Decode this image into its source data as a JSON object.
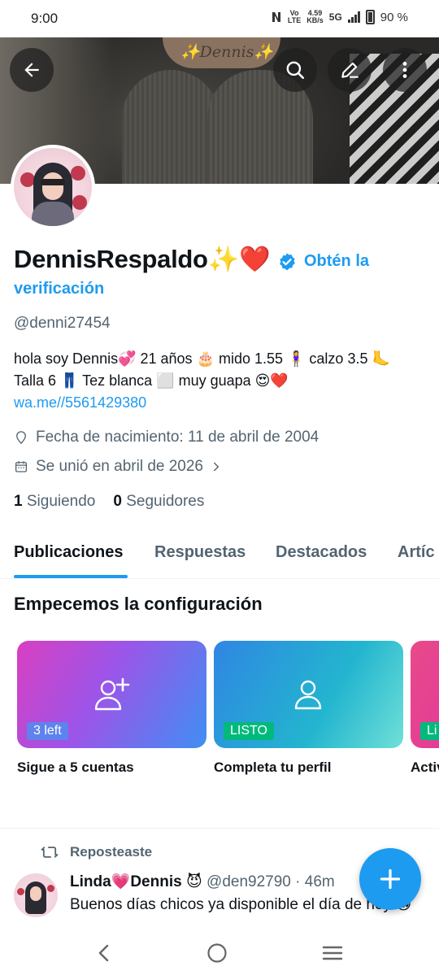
{
  "status_bar": {
    "time": "9:00",
    "network_top": "Vo",
    "network_bottom": "LTE",
    "speed_top": "4.59",
    "speed_bottom": "KB/s",
    "network_type": "5G",
    "battery": "90 %"
  },
  "banner": {
    "tattoo_text": "✨Dennis✨",
    "icons": [
      "back-arrow-icon",
      "search-icon",
      "edit-icon",
      "more-vertical-icon"
    ]
  },
  "profile": {
    "display_name": "DennisRespaldo✨❤️",
    "verify_link_line1": "Obtén la",
    "verify_link_line2": "verificación",
    "handle": "@denni27454",
    "bio_text": "hola soy Dennis💞 21 años 🎂 mido 1.55 🧍‍♀️ calzo 3.5 🦶 Talla 6 👖 Tez blanca ⬜ muy guapa 😍❤️ ",
    "bio_link": "wa.me//5561429380",
    "birthdate": "Fecha de nacimiento: 11 de abril de 2004",
    "joined": "Se unió en abril de 2026",
    "following_count": "1",
    "following_label": "Siguiendo",
    "followers_count": "0",
    "followers_label": "Seguidores"
  },
  "tabs": [
    {
      "label": "Publicaciones",
      "active": true
    },
    {
      "label": "Respuestas",
      "active": false
    },
    {
      "label": "Destacados",
      "active": false
    },
    {
      "label": "Artíc",
      "active": false
    }
  ],
  "setup": {
    "title": "Empecemos la configuración",
    "cards": [
      {
        "badge": "3 left",
        "label": "Sigue a 5 cuentas",
        "icon": "add-user-icon"
      },
      {
        "badge": "LISTO",
        "label": "Completa tu perfil",
        "icon": "user-icon"
      },
      {
        "badge": "Li",
        "label": "Activ",
        "icon": ""
      }
    ]
  },
  "post": {
    "repost_label": "Reposteaste",
    "author_name": "Linda💗Dennis 😈",
    "author_handle": "@den92790 · 46m",
    "text": "Buenos días chicos ya disponible el día de hoy 😘"
  },
  "colors": {
    "accent": "#1d9bf0",
    "text": "#0f1419",
    "secondary_text": "#536471",
    "badge_green": "#00ba7c"
  }
}
